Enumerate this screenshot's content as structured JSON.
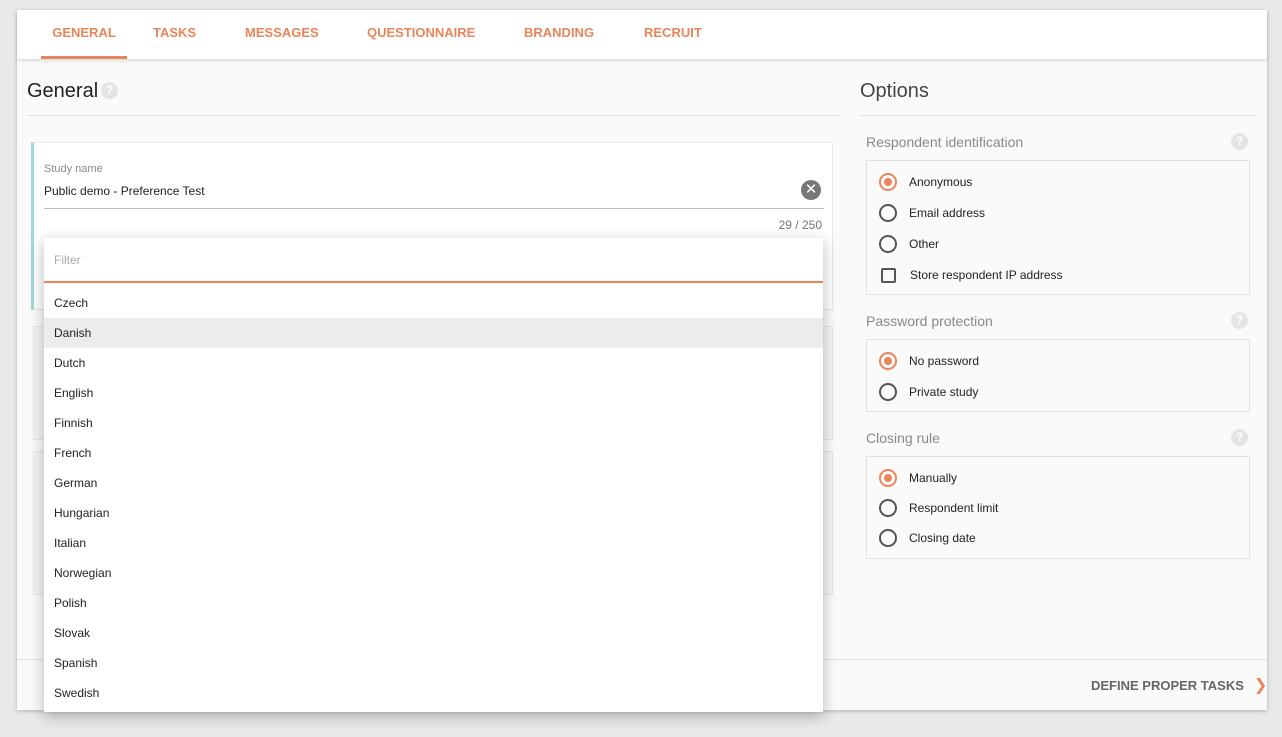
{
  "tabs": [
    {
      "label": "GENERAL",
      "active": true
    },
    {
      "label": "TASKS"
    },
    {
      "label": "MESSAGES"
    },
    {
      "label": "QUESTIONNAIRE"
    },
    {
      "label": "BRANDING"
    },
    {
      "label": "RECRUIT"
    }
  ],
  "general": {
    "title": "General",
    "help_icon": "help-icon",
    "study_name": {
      "label": "Study name",
      "value": "Public demo - Preference Test",
      "counter": "29 / 250",
      "clear_icon": "close-circle-icon"
    }
  },
  "language_dropdown": {
    "filter_placeholder": "Filter",
    "hovered": "Danish",
    "options": [
      "Czech",
      "Danish",
      "Dutch",
      "English",
      "Finnish",
      "French",
      "German",
      "Hungarian",
      "Italian",
      "Norwegian",
      "Polish",
      "Slovak",
      "Spanish",
      "Swedish"
    ]
  },
  "options": {
    "title": "Options",
    "respondent_identification": {
      "label": "Respondent identification",
      "choices": [
        "Anonymous",
        "Email address",
        "Other"
      ],
      "selected": "Anonymous",
      "store_ip_label": "Store respondent IP address",
      "store_ip_checked": false
    },
    "password_protection": {
      "label": "Password protection",
      "choices": [
        "No password",
        "Private study"
      ],
      "selected": "No password"
    },
    "closing_rule": {
      "label": "Closing rule",
      "choices": [
        "Manually",
        "Respondent limit",
        "Closing date"
      ],
      "selected": "Manually"
    }
  },
  "footer": {
    "next_label": "DEFINE PROPER TASKS",
    "next_icon": "chevron-right-icon"
  },
  "colors": {
    "accent": "#e8855a",
    "study_border": "#9fd7d7"
  }
}
